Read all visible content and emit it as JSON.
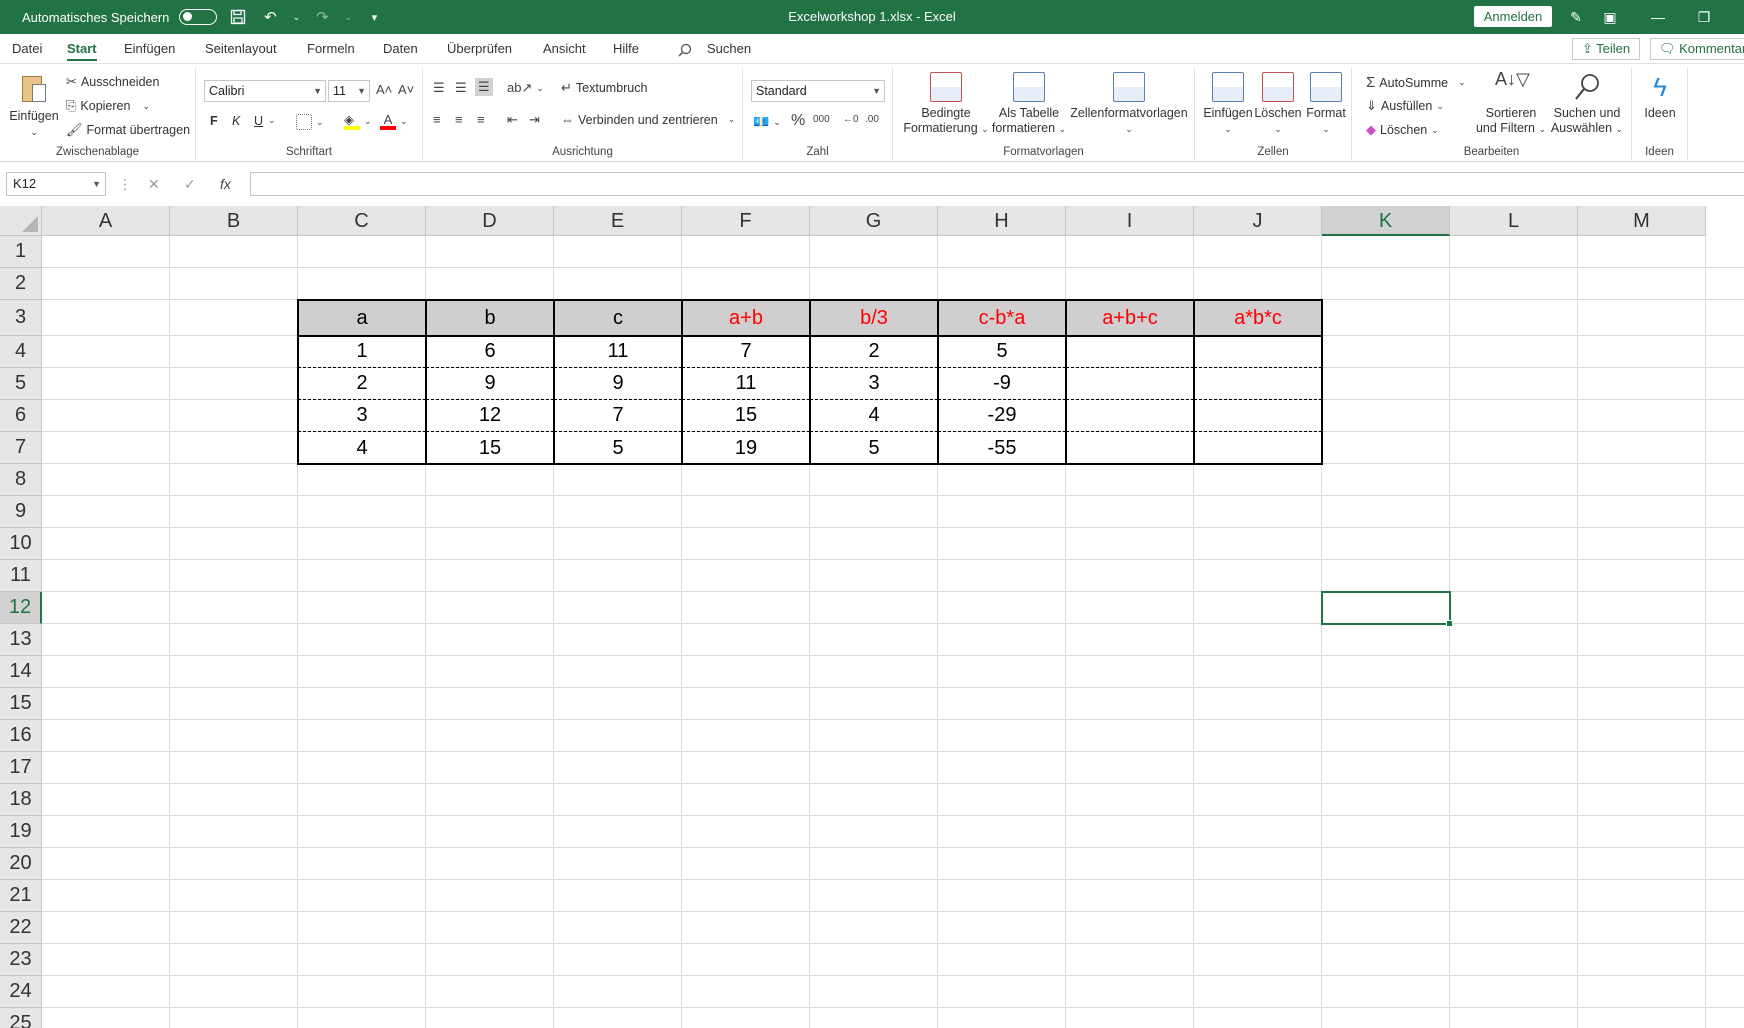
{
  "titlebar": {
    "autosave_label": "Automatisches Speichern",
    "doc_title": "Excelworkshop 1.xlsx  -  Excel",
    "signin_label": "Anmelden"
  },
  "menu": {
    "items": [
      "Datei",
      "Start",
      "Einfügen",
      "Seitenlayout",
      "Formeln",
      "Daten",
      "Überprüfen",
      "Ansicht",
      "Hilfe"
    ],
    "active": "Start",
    "search_label": "Suchen",
    "share_label": "Teilen",
    "comment_label": "Kommentare"
  },
  "ribbon": {
    "clipboard": {
      "paste": "Einfügen",
      "cut": "Ausschneiden",
      "copy": "Kopieren",
      "format_painter": "Format übertragen",
      "label": "Zwischenablage"
    },
    "font": {
      "name": "Calibri",
      "size": "11",
      "bold": "F",
      "italic": "K",
      "underline": "U",
      "label": "Schriftart"
    },
    "alignment": {
      "wrap": "Textumbruch",
      "merge": "Verbinden und zentrieren",
      "label": "Ausrichtung"
    },
    "number": {
      "format": "Standard",
      "label": "Zahl"
    },
    "styles": {
      "conditional": [
        "Bedingte",
        "Formatierung"
      ],
      "as_table": [
        "Als Tabelle",
        "formatieren"
      ],
      "cell_styles": "Zellenformatvorlagen",
      "label": "Formatvorlagen"
    },
    "cells": {
      "insert": "Einfügen",
      "delete": "Löschen",
      "format": "Format",
      "label": "Zellen"
    },
    "editing": {
      "autosum": "AutoSumme",
      "fill": "Ausfüllen",
      "clear": "Löschen",
      "sort": [
        "Sortieren",
        "und Filtern"
      ],
      "find": [
        "Suchen und",
        "Auswählen"
      ],
      "label": "Bearbeiten"
    },
    "ideas": {
      "button": "Ideen",
      "label": "Ideen"
    }
  },
  "formulabar": {
    "namebox": "K12",
    "formula": "",
    "fx": "fx"
  },
  "sheet": {
    "columns": [
      "A",
      "B",
      "C",
      "D",
      "E",
      "F",
      "G",
      "H",
      "I",
      "J",
      "K",
      "L",
      "M"
    ],
    "selected_column": "K",
    "selected_row": 12,
    "rows": [
      1,
      2,
      3,
      4,
      5,
      6,
      7,
      8,
      9,
      10,
      11,
      12,
      13,
      14,
      15,
      16,
      17,
      18,
      19,
      20,
      21,
      22,
      23,
      24,
      25
    ],
    "table": {
      "headers": [
        "a",
        "b",
        "c",
        "a+b",
        "b/3",
        "c-b*a",
        "a+b+c",
        "a*b*c"
      ],
      "header_red": [
        false,
        false,
        false,
        true,
        true,
        true,
        true,
        true
      ],
      "data": [
        [
          "1",
          "6",
          "11",
          "7",
          "2",
          "5",
          "",
          ""
        ],
        [
          "2",
          "9",
          "9",
          "11",
          "3",
          "-9",
          "",
          ""
        ],
        [
          "3",
          "12",
          "7",
          "15",
          "4",
          "-29",
          "",
          ""
        ],
        [
          "4",
          "15",
          "5",
          "19",
          "5",
          "-55",
          "",
          ""
        ]
      ]
    }
  },
  "colors": {
    "accent": "#217346",
    "header_fill": "#d0cece",
    "formula_red": "#ff0000"
  }
}
